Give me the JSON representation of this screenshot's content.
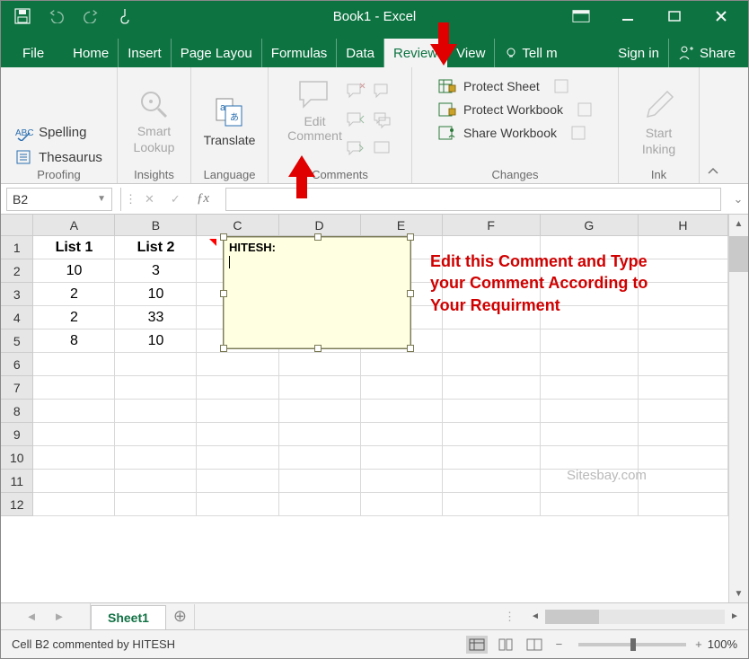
{
  "title": "Book1 - Excel",
  "menus": {
    "file": "File",
    "home": "Home",
    "insert": "Insert",
    "page_layout": "Page Layou",
    "formulas": "Formulas",
    "data": "Data",
    "review": "Review",
    "view": "View",
    "tell": "Tell m",
    "signin": "Sign in",
    "share": "Share"
  },
  "ribbon": {
    "proofing": {
      "label": "Proofing",
      "spelling": "Spelling",
      "thesaurus": "Thesaurus"
    },
    "insights": {
      "label": "Insights",
      "smart": "Smart",
      "lookup": "Lookup"
    },
    "language": {
      "label": "Language",
      "translate": "Translate"
    },
    "comments": {
      "label": "Comments",
      "edit1": "Edit",
      "edit2": "Comment"
    },
    "changes": {
      "label": "Changes",
      "protect_sheet": "Protect Sheet",
      "protect_wb": "Protect Workbook",
      "share_wb": "Share Workbook"
    },
    "ink": {
      "label": "Ink",
      "start": "Start",
      "inking": "Inking"
    }
  },
  "namebox": "B2",
  "columns": [
    "A",
    "B",
    "C",
    "D",
    "E",
    "F",
    "G",
    "H"
  ],
  "rows": [
    "1",
    "2",
    "3",
    "4",
    "5",
    "6",
    "7",
    "8",
    "9",
    "10",
    "11",
    "12"
  ],
  "data": {
    "A": {
      "1": "List 1",
      "2": "10",
      "3": "2",
      "4": "2",
      "5": "8"
    },
    "B": {
      "1": "List 2",
      "2": "3",
      "3": "10",
      "4": "33",
      "5": "10"
    }
  },
  "comment": {
    "author": "HITESH:"
  },
  "annotation": {
    "l1": "Edit this Comment and Type",
    "l2": "your Comment According to",
    "l3": "Your Requirment"
  },
  "watermark": "Sitesbay.com",
  "sheet": "Sheet1",
  "status": "Cell B2 commented by HITESH",
  "zoom": "100%"
}
